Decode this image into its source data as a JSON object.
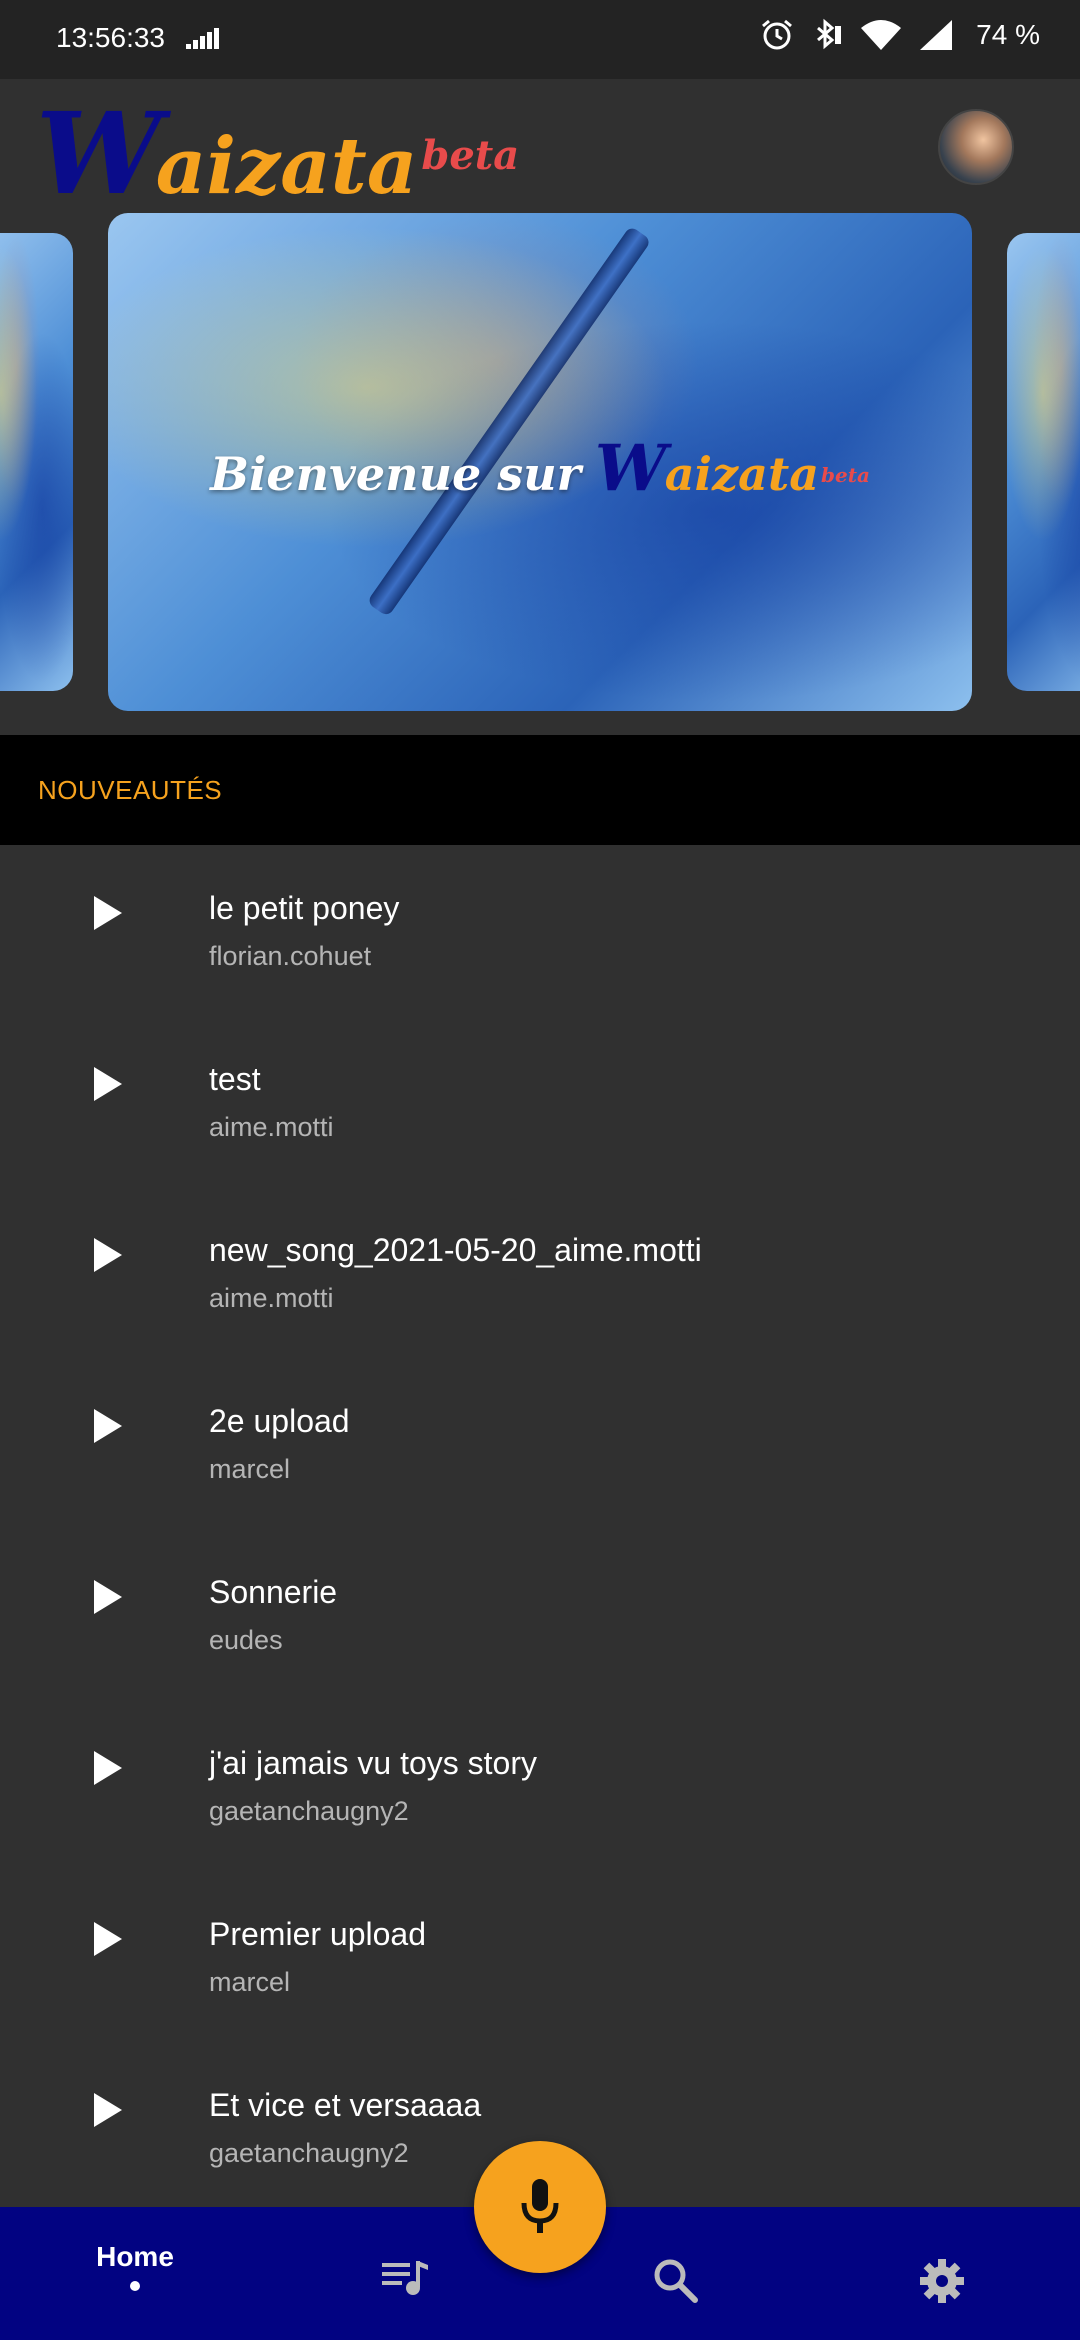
{
  "status_bar": {
    "time": "13:56:33",
    "battery": "74 %",
    "icons": [
      "data-speed-icon",
      "alarm-icon",
      "bluetooth-icon",
      "wifi-icon",
      "signal-icon"
    ]
  },
  "header": {
    "logo_w": "W",
    "logo_rest": "aizata",
    "logo_beta": "beta",
    "avatar_icon": "user-avatar"
  },
  "carousel": {
    "welcome_text": "Bienvenue sur",
    "logo_w": "W",
    "logo_rest": "aizata",
    "logo_beta": "beta"
  },
  "section": {
    "title": "NOUVEAUTÉS"
  },
  "songs": [
    {
      "title": "le petit poney",
      "artist": "florian.cohuet"
    },
    {
      "title": "test",
      "artist": "aime.motti"
    },
    {
      "title": "new_song_2021-05-20_aime.motti",
      "artist": "aime.motti"
    },
    {
      "title": "2e upload",
      "artist": "marcel"
    },
    {
      "title": "Sonnerie",
      "artist": "eudes"
    },
    {
      "title": "j'ai jamais vu toys story",
      "artist": "gaetanchaugny2"
    },
    {
      "title": "Premier upload",
      "artist": "marcel"
    },
    {
      "title": "Et vice et versaaaa",
      "artist": "gaetanchaugny2"
    }
  ],
  "nav": {
    "home_label": "Home",
    "icons": [
      "playlist-icon",
      "search-icon",
      "settings-icon"
    ],
    "fab_icon": "microphone-icon"
  },
  "colors": {
    "background": "#303030",
    "accent": "#f6a21e",
    "nav_background": "#020382",
    "logo_blue": "#0a0c8a",
    "beta_red": "#e84b4b"
  }
}
